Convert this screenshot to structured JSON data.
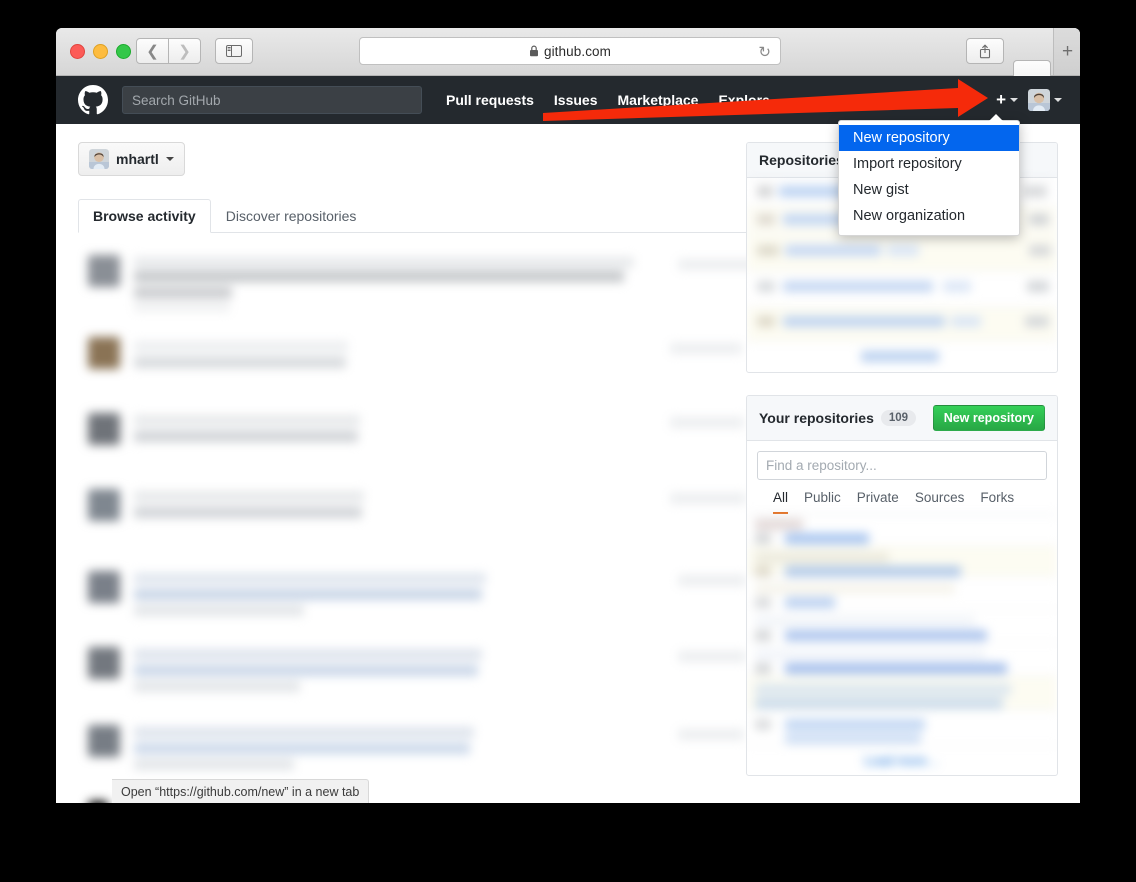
{
  "browser": {
    "url": "github.com",
    "lock_icon": "lock-icon",
    "reload_icon": "reload-icon",
    "back_icon": "chevron-left-icon",
    "forward_icon": "chevron-right-icon",
    "sidebar_icon": "sidebar-toggle-icon",
    "share_icon": "share-icon",
    "tabs_icon": "show-tabs-icon",
    "newtab_label": "+"
  },
  "header": {
    "logo_icon": "github-logo-icon",
    "search_placeholder": "Search GitHub",
    "search_value": "",
    "nav": [
      {
        "label": "Pull requests"
      },
      {
        "label": "Issues"
      },
      {
        "label": "Marketplace"
      },
      {
        "label": "Explore"
      }
    ],
    "plus_label": "+",
    "plus_caret_icon": "chevron-down-icon",
    "avatar_icon": "user-avatar",
    "avatar_caret_icon": "chevron-down-icon"
  },
  "dropdown": {
    "items": [
      {
        "label": "New repository",
        "active": true
      },
      {
        "label": "Import repository",
        "active": false
      },
      {
        "label": "New gist",
        "active": false
      },
      {
        "label": "New organization",
        "active": false
      }
    ]
  },
  "left": {
    "user_pill": {
      "username": "mhartl",
      "avatar_icon": "user-avatar",
      "caret_icon": "chevron-down-icon"
    },
    "tabs": [
      {
        "label": "Browse activity",
        "active": true
      },
      {
        "label": "Discover repositories",
        "active": false
      }
    ],
    "feed_note": "blurred-activity-feed"
  },
  "right": {
    "repositories_panel": {
      "title": "Repositories",
      "rows_note": "blurred-repository-rows"
    },
    "your_repositories_panel": {
      "title": "Your repositories",
      "count": "109",
      "new_repository_label": "New repository",
      "search_placeholder": "Find a repository...",
      "search_value": "",
      "filters": [
        {
          "label": "All",
          "active": true
        },
        {
          "label": "Public",
          "active": false
        },
        {
          "label": "Private",
          "active": false
        },
        {
          "label": "Sources",
          "active": false
        },
        {
          "label": "Forks",
          "active": false
        }
      ],
      "load_more_label": "Load more…"
    }
  },
  "statusbar": {
    "text": "Open “https://github.com/new” in a new tab"
  },
  "annotation": {
    "arrow_color": "#f52a0a",
    "arrow_target": "plus-button"
  },
  "colors": {
    "header_bg": "#24292e",
    "accent_blue": "#0366ee",
    "green_button": "#28a745",
    "filter_underline": "#e36209",
    "link_blue": "#0366d6"
  }
}
